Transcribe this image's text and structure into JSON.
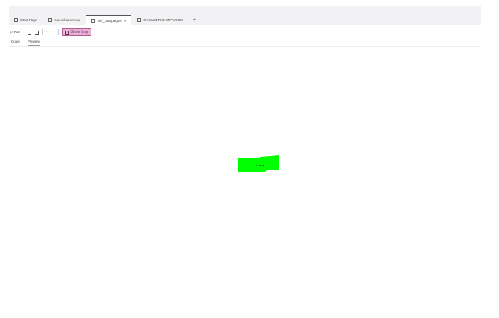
{
  "tabs": [
    {
      "label": "Start Page",
      "icon": "page-icon"
    },
    {
      "label": "cancel abort.sas",
      "icon": "program-icon"
    },
    {
      "label": "def_campaigns",
      "icon": "program-icon",
      "active": true,
      "close": "×"
    },
    {
      "label": "CASUSER.CAMPAIGNS",
      "icon": "table-icon"
    }
  ],
  "add_tab": "+",
  "toolbar": {
    "run": "▷ Run",
    "undo": "↶",
    "redo": "↷",
    "show_log": "Show Log"
  },
  "subtabs": [
    "Code",
    "Preview"
  ],
  "colors": {
    "loader": "#00ff00",
    "show_log_bg": "#e6b3d4"
  }
}
